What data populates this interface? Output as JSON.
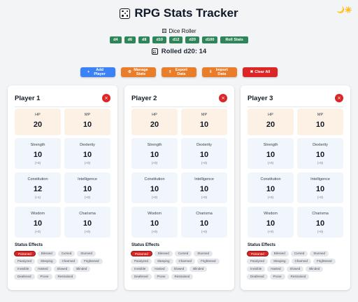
{
  "app": {
    "title": "RPG Stats Tracker",
    "theme_toggle": "🌙☀️"
  },
  "dice_roller": {
    "title": "Dice Roller",
    "buttons": [
      "d4",
      "d6",
      "d8",
      "d10",
      "d12",
      "d20",
      "d100",
      "Roll Stats"
    ],
    "result": "Rolled d20: 14"
  },
  "actions": {
    "add_player": "Add Player",
    "manage_stats": "Manage Stats",
    "export_data": "Export Data",
    "import_data": "Import Data",
    "clear_all": "Clear All"
  },
  "players": [
    {
      "name": "Player 1",
      "remove": "×",
      "vitals": [
        {
          "label": "HP",
          "value": "20"
        },
        {
          "label": "MP",
          "value": "10"
        }
      ],
      "attributes": [
        {
          "label": "Strength",
          "value": "10",
          "mod": "(+0)"
        },
        {
          "label": "Dexterity",
          "value": "10",
          "mod": "(+0)"
        },
        {
          "label": "Constitution",
          "value": "12",
          "mod": "(+1)"
        },
        {
          "label": "Intelligence",
          "value": "10",
          "mod": "(+0)"
        },
        {
          "label": "Wisdom",
          "value": "10",
          "mod": "(+0)"
        },
        {
          "label": "Charisma",
          "value": "10",
          "mod": "(+0)"
        }
      ],
      "status_title": "Status Effects",
      "status_effects": [
        "Poisoned",
        "Blessed",
        "Cursed",
        "Stunned",
        "Paralyzed",
        "Sleeping",
        "Charmed",
        "Frightened",
        "Invisible",
        "Hasted",
        "Slowed",
        "Blinded",
        "Deafened",
        "Prone",
        "Restrained"
      ],
      "active_effects": [
        "Poisoned"
      ]
    },
    {
      "name": "Player 2",
      "remove": "×",
      "vitals": [
        {
          "label": "HP",
          "value": "20"
        },
        {
          "label": "MP",
          "value": "10"
        }
      ],
      "attributes": [
        {
          "label": "Strength",
          "value": "10",
          "mod": "(+0)"
        },
        {
          "label": "Dexterity",
          "value": "10",
          "mod": "(+0)"
        },
        {
          "label": "Constitution",
          "value": "10",
          "mod": "(+0)"
        },
        {
          "label": "Intelligence",
          "value": "10",
          "mod": "(+0)"
        },
        {
          "label": "Wisdom",
          "value": "10",
          "mod": "(+0)"
        },
        {
          "label": "Charisma",
          "value": "10",
          "mod": "(+0)"
        }
      ],
      "status_title": "Status Effects",
      "status_effects": [
        "Poisoned",
        "Blessed",
        "Cursed",
        "Stunned",
        "Paralyzed",
        "Sleeping",
        "Charmed",
        "Frightened",
        "Invisible",
        "Hasted",
        "Slowed",
        "Blinded",
        "Deafened",
        "Prone",
        "Restrained"
      ],
      "active_effects": [
        "Poisoned"
      ]
    },
    {
      "name": "Player 3",
      "remove": "×",
      "vitals": [
        {
          "label": "HP",
          "value": "20"
        },
        {
          "label": "MP",
          "value": "10"
        }
      ],
      "attributes": [
        {
          "label": "Strength",
          "value": "10",
          "mod": "(+0)"
        },
        {
          "label": "Dexterity",
          "value": "10",
          "mod": "(+0)"
        },
        {
          "label": "Constitution",
          "value": "10",
          "mod": "(+0)"
        },
        {
          "label": "Intelligence",
          "value": "10",
          "mod": "(+0)"
        },
        {
          "label": "Wisdom",
          "value": "10",
          "mod": "(+0)"
        },
        {
          "label": "Charisma",
          "value": "10",
          "mod": "(+0)"
        }
      ],
      "status_title": "Status Effects",
      "status_effects": [
        "Poisoned",
        "Blessed",
        "Cursed",
        "Stunned",
        "Paralyzed",
        "Sleeping",
        "Charmed",
        "Frightened",
        "Invisible",
        "Hasted",
        "Slowed",
        "Blinded",
        "Deafened",
        "Prone",
        "Restrained"
      ],
      "active_effects": [
        "Poisoned"
      ]
    }
  ],
  "colors": {
    "dice_green": "#2f855a",
    "primary_blue": "#3b82f6",
    "orange": "#ea7d2a",
    "danger_red": "#dc2626",
    "vital_bg": "#fdf1e5",
    "attr_bg": "#f0f6fb"
  }
}
